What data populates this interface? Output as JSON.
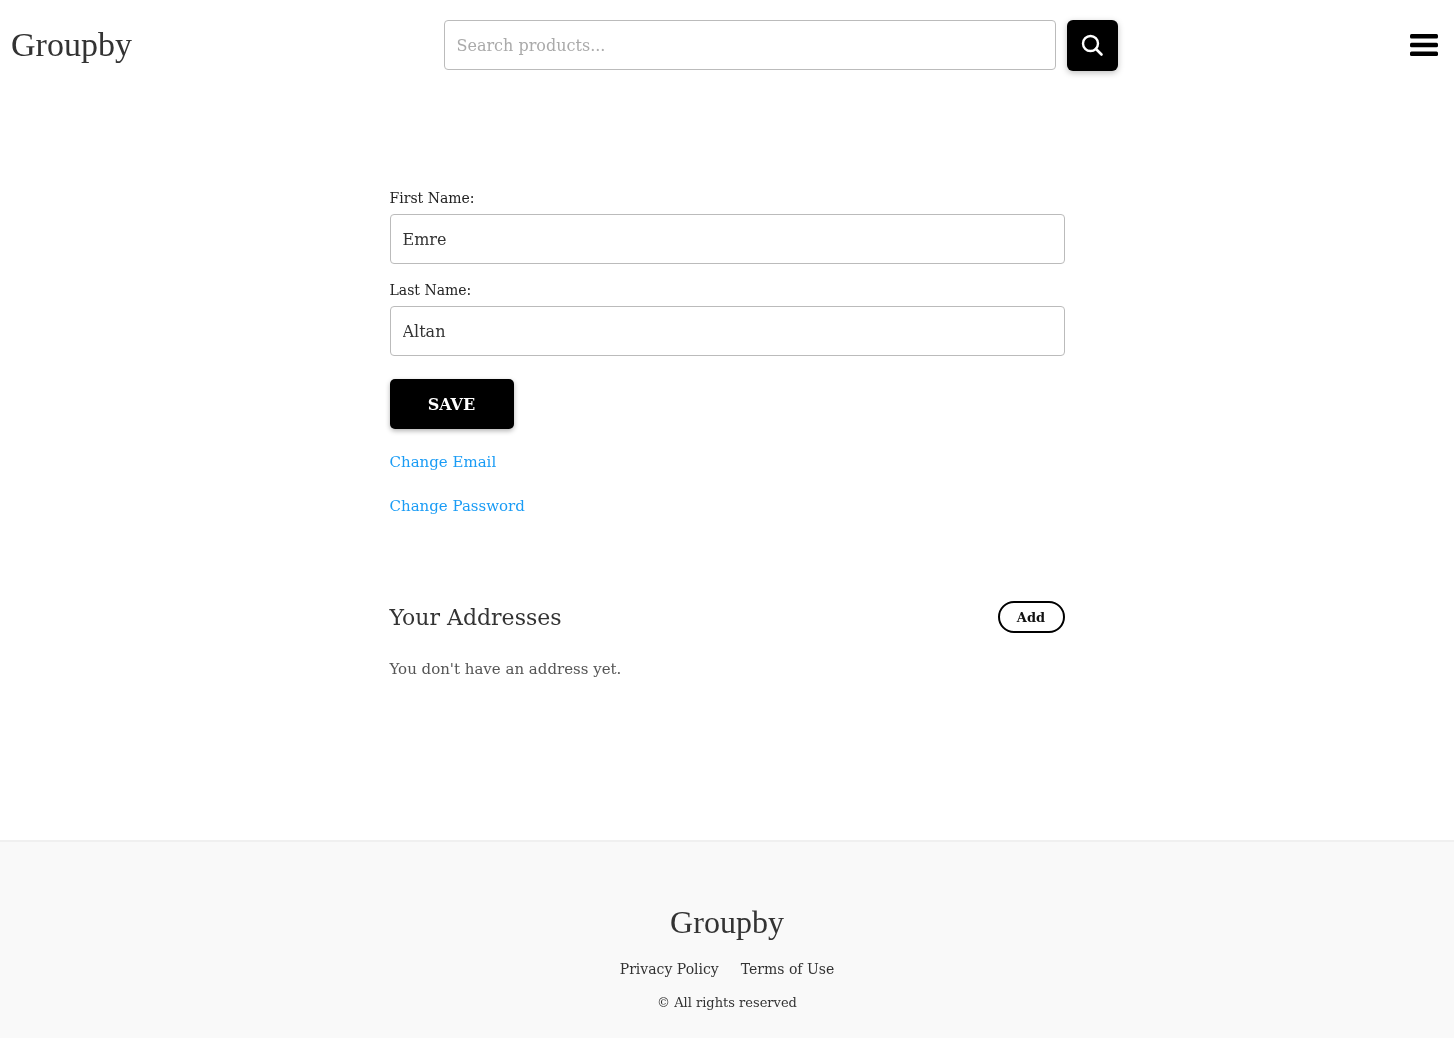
{
  "header": {
    "logo": "Groupby",
    "search": {
      "placeholder": "Search products..."
    }
  },
  "profile": {
    "fields": [
      {
        "label": "First Name:",
        "value": "Emre"
      },
      {
        "label": "Last Name:",
        "value": "Altan"
      }
    ],
    "save_button": "SAVE",
    "links": [
      "Change Email",
      "Change Password"
    ]
  },
  "addresses": {
    "title": "Your Addresses",
    "add_button": "Add",
    "empty_message": "You don't have an address yet."
  },
  "footer": {
    "logo": "Groupby",
    "links": [
      "Privacy Policy",
      "Terms of Use"
    ],
    "copyright": "© All rights reserved"
  }
}
